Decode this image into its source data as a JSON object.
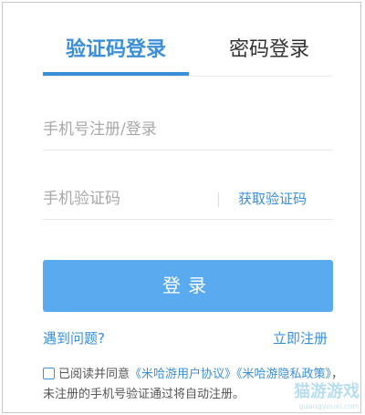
{
  "tabs": {
    "sms_login": "验证码登录",
    "password_login": "密码登录"
  },
  "form": {
    "phone_placeholder": "手机号注册/登录",
    "code_placeholder": "手机验证码",
    "get_code_label": "获取验证码",
    "login_label": "登录"
  },
  "links": {
    "help": "遇到问题?",
    "register": "立即注册"
  },
  "agreement": {
    "prefix": "已阅读并同意",
    "user_agreement": "《米哈游用户协议》",
    "privacy_policy": "《米哈游隐私政策》",
    "suffix": "，未注册的手机号验证通过将自动注册。"
  },
  "watermark": {
    "text": "猫游游戏",
    "sub": "guangyouxi.com"
  },
  "colors": {
    "accent": "#3a8fd8",
    "button": "#5aaaf0"
  }
}
